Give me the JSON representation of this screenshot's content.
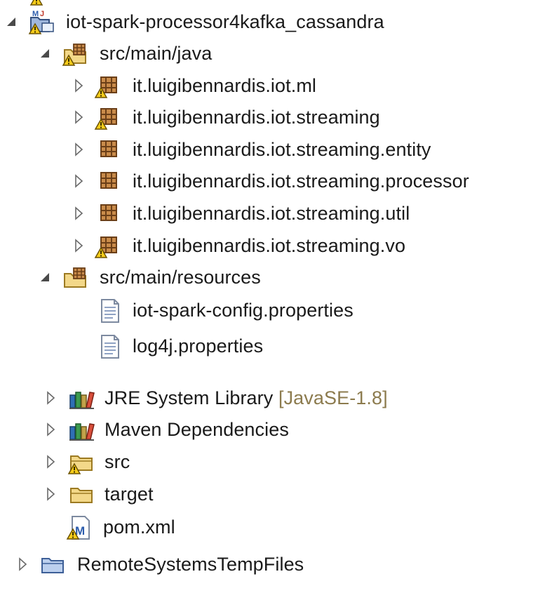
{
  "tree": {
    "top_partial_item": "",
    "project": {
      "label": "iot-spark-processor4kafka_cassandra",
      "expanded": true,
      "icon": "maven-java-project-icon"
    },
    "src_main_java": {
      "label": "src/main/java",
      "expanded": true,
      "icon": "source-folder-warning-icon",
      "packages": [
        {
          "label": "it.luigibennardis.iot.ml",
          "icon": "package-warning-icon"
        },
        {
          "label": "it.luigibennardis.iot.streaming",
          "icon": "package-warning-icon"
        },
        {
          "label": "it.luigibennardis.iot.streaming.entity",
          "icon": "package-icon"
        },
        {
          "label": "it.luigibennardis.iot.streaming.processor",
          "icon": "package-icon"
        },
        {
          "label": "it.luigibennardis.iot.streaming.util",
          "icon": "package-icon"
        },
        {
          "label": "it.luigibennardis.iot.streaming.vo",
          "icon": "package-warning-icon"
        }
      ]
    },
    "src_main_resources": {
      "label": "src/main/resources",
      "expanded": true,
      "icon": "source-folder-icon",
      "files": [
        {
          "label": "iot-spark-config.properties",
          "icon": "properties-file-icon"
        },
        {
          "label": "log4j.properties",
          "icon": "properties-file-icon"
        }
      ]
    },
    "jre": {
      "label": "JRE System Library",
      "decoration": "[JavaSE-1.8]",
      "icon": "library-icon"
    },
    "maven_deps": {
      "label": "Maven Dependencies",
      "icon": "library-icon"
    },
    "src": {
      "label": "src",
      "icon": "folder-warning-icon"
    },
    "target": {
      "label": "target",
      "icon": "folder-icon"
    },
    "pom": {
      "label": "pom.xml",
      "icon": "maven-pom-warning-icon"
    },
    "remote": {
      "label": "RemoteSystemsTempFiles",
      "icon": "project-folder-icon"
    }
  },
  "colors": {
    "package": "#8a5a2b",
    "folder": "#e8c66a",
    "warning": "#f2c400",
    "decoration": "#8c7b4e",
    "maven_blue": "#2b5cad"
  }
}
